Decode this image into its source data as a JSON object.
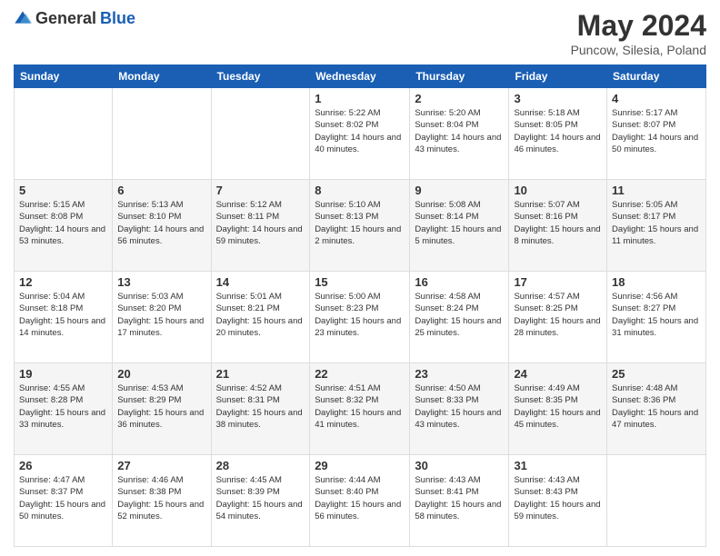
{
  "header": {
    "logo_general": "General",
    "logo_blue": "Blue",
    "title": "May 2024",
    "location": "Puncow, Silesia, Poland"
  },
  "calendar": {
    "days_of_week": [
      "Sunday",
      "Monday",
      "Tuesday",
      "Wednesday",
      "Thursday",
      "Friday",
      "Saturday"
    ],
    "weeks": [
      [
        {
          "day": "",
          "info": ""
        },
        {
          "day": "",
          "info": ""
        },
        {
          "day": "",
          "info": ""
        },
        {
          "day": "1",
          "info": "Sunrise: 5:22 AM\nSunset: 8:02 PM\nDaylight: 14 hours and 40 minutes."
        },
        {
          "day": "2",
          "info": "Sunrise: 5:20 AM\nSunset: 8:04 PM\nDaylight: 14 hours and 43 minutes."
        },
        {
          "day": "3",
          "info": "Sunrise: 5:18 AM\nSunset: 8:05 PM\nDaylight: 14 hours and 46 minutes."
        },
        {
          "day": "4",
          "info": "Sunrise: 5:17 AM\nSunset: 8:07 PM\nDaylight: 14 hours and 50 minutes."
        }
      ],
      [
        {
          "day": "5",
          "info": "Sunrise: 5:15 AM\nSunset: 8:08 PM\nDaylight: 14 hours and 53 minutes."
        },
        {
          "day": "6",
          "info": "Sunrise: 5:13 AM\nSunset: 8:10 PM\nDaylight: 14 hours and 56 minutes."
        },
        {
          "day": "7",
          "info": "Sunrise: 5:12 AM\nSunset: 8:11 PM\nDaylight: 14 hours and 59 minutes."
        },
        {
          "day": "8",
          "info": "Sunrise: 5:10 AM\nSunset: 8:13 PM\nDaylight: 15 hours and 2 minutes."
        },
        {
          "day": "9",
          "info": "Sunrise: 5:08 AM\nSunset: 8:14 PM\nDaylight: 15 hours and 5 minutes."
        },
        {
          "day": "10",
          "info": "Sunrise: 5:07 AM\nSunset: 8:16 PM\nDaylight: 15 hours and 8 minutes."
        },
        {
          "day": "11",
          "info": "Sunrise: 5:05 AM\nSunset: 8:17 PM\nDaylight: 15 hours and 11 minutes."
        }
      ],
      [
        {
          "day": "12",
          "info": "Sunrise: 5:04 AM\nSunset: 8:18 PM\nDaylight: 15 hours and 14 minutes."
        },
        {
          "day": "13",
          "info": "Sunrise: 5:03 AM\nSunset: 8:20 PM\nDaylight: 15 hours and 17 minutes."
        },
        {
          "day": "14",
          "info": "Sunrise: 5:01 AM\nSunset: 8:21 PM\nDaylight: 15 hours and 20 minutes."
        },
        {
          "day": "15",
          "info": "Sunrise: 5:00 AM\nSunset: 8:23 PM\nDaylight: 15 hours and 23 minutes."
        },
        {
          "day": "16",
          "info": "Sunrise: 4:58 AM\nSunset: 8:24 PM\nDaylight: 15 hours and 25 minutes."
        },
        {
          "day": "17",
          "info": "Sunrise: 4:57 AM\nSunset: 8:25 PM\nDaylight: 15 hours and 28 minutes."
        },
        {
          "day": "18",
          "info": "Sunrise: 4:56 AM\nSunset: 8:27 PM\nDaylight: 15 hours and 31 minutes."
        }
      ],
      [
        {
          "day": "19",
          "info": "Sunrise: 4:55 AM\nSunset: 8:28 PM\nDaylight: 15 hours and 33 minutes."
        },
        {
          "day": "20",
          "info": "Sunrise: 4:53 AM\nSunset: 8:29 PM\nDaylight: 15 hours and 36 minutes."
        },
        {
          "day": "21",
          "info": "Sunrise: 4:52 AM\nSunset: 8:31 PM\nDaylight: 15 hours and 38 minutes."
        },
        {
          "day": "22",
          "info": "Sunrise: 4:51 AM\nSunset: 8:32 PM\nDaylight: 15 hours and 41 minutes."
        },
        {
          "day": "23",
          "info": "Sunrise: 4:50 AM\nSunset: 8:33 PM\nDaylight: 15 hours and 43 minutes."
        },
        {
          "day": "24",
          "info": "Sunrise: 4:49 AM\nSunset: 8:35 PM\nDaylight: 15 hours and 45 minutes."
        },
        {
          "day": "25",
          "info": "Sunrise: 4:48 AM\nSunset: 8:36 PM\nDaylight: 15 hours and 47 minutes."
        }
      ],
      [
        {
          "day": "26",
          "info": "Sunrise: 4:47 AM\nSunset: 8:37 PM\nDaylight: 15 hours and 50 minutes."
        },
        {
          "day": "27",
          "info": "Sunrise: 4:46 AM\nSunset: 8:38 PM\nDaylight: 15 hours and 52 minutes."
        },
        {
          "day": "28",
          "info": "Sunrise: 4:45 AM\nSunset: 8:39 PM\nDaylight: 15 hours and 54 minutes."
        },
        {
          "day": "29",
          "info": "Sunrise: 4:44 AM\nSunset: 8:40 PM\nDaylight: 15 hours and 56 minutes."
        },
        {
          "day": "30",
          "info": "Sunrise: 4:43 AM\nSunset: 8:41 PM\nDaylight: 15 hours and 58 minutes."
        },
        {
          "day": "31",
          "info": "Sunrise: 4:43 AM\nSunset: 8:43 PM\nDaylight: 15 hours and 59 minutes."
        },
        {
          "day": "",
          "info": ""
        }
      ]
    ]
  }
}
